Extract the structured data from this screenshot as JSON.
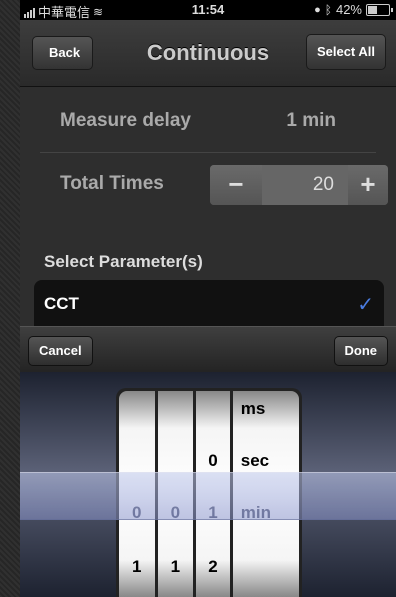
{
  "status_bar": {
    "carrier": "中華電信",
    "time": "11:54",
    "battery": "42%"
  },
  "navbar": {
    "back_label": "Back",
    "title": "Continuous",
    "select_all_label": "Select All"
  },
  "settings": {
    "measure_delay": {
      "label": "Measure delay",
      "value": "1 min"
    },
    "total_times": {
      "label": "Total Times",
      "minus": "−",
      "value": "20",
      "plus": "+"
    }
  },
  "section": {
    "header": "Select Parameter(s)"
  },
  "parameters": [
    {
      "label": "CCT",
      "checked": true,
      "check_mark": "✓"
    }
  ],
  "toolbar": {
    "cancel_label": "Cancel",
    "done_label": "Done"
  },
  "picker": {
    "columns": [
      {
        "cells": [
          "",
          "",
          "0",
          "1"
        ]
      },
      {
        "cells": [
          "",
          "",
          "0",
          "1"
        ]
      },
      {
        "cells": [
          "",
          "0",
          "1",
          "2"
        ]
      },
      {
        "cells": [
          "ms",
          "sec",
          "min",
          ""
        ]
      }
    ],
    "selected_row": 2
  },
  "colors": {
    "accent_check": "#4a7ce0",
    "selection_band": "#aab2e0"
  }
}
